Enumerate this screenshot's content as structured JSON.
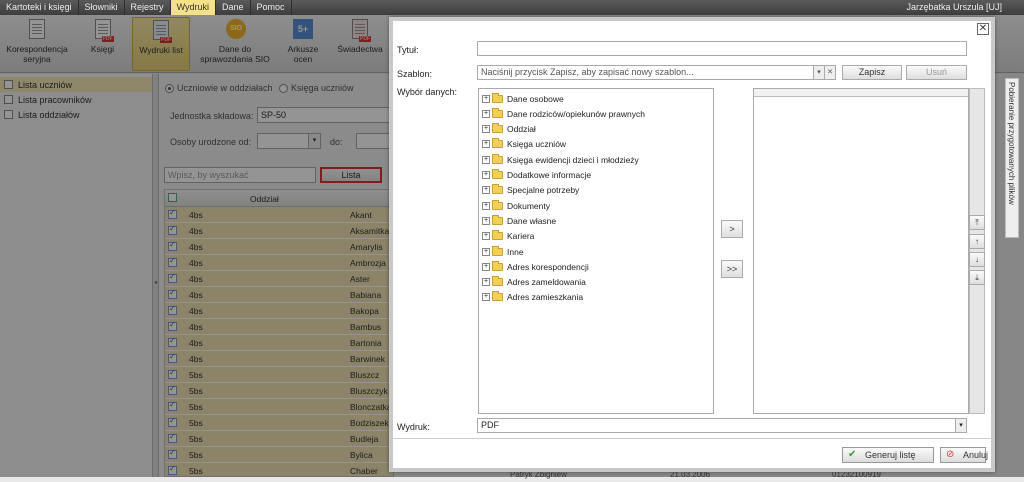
{
  "menu": [
    "Kartoteki i księgi",
    "Słowniki",
    "Rejestry",
    "Wydruki",
    "Dane",
    "Pomoc"
  ],
  "menu_active": 3,
  "user": "Jarzębatka Urszula [UJ]",
  "ribbon": [
    {
      "label": "Korespondencja seryjna",
      "icon": "document-icon"
    },
    {
      "label": "Księgi",
      "icon": "pdf-book-icon"
    },
    {
      "label": "Wydruki list",
      "icon": "list-pdf-icon"
    },
    {
      "label": "Dane do sprawozdania SIO",
      "icon": "sio-icon"
    },
    {
      "label": "Arkusze ocen",
      "icon": "grade-sheet-icon"
    },
    {
      "label": "Świadectwa",
      "icon": "certificate-icon"
    }
  ],
  "sidebar": [
    "Lista uczniów",
    "Lista pracowników",
    "Lista oddziałów"
  ],
  "filters": {
    "radio1": "Uczniowie w oddziałach",
    "radio2": "Księga uczniów",
    "unit_label": "Jednostka składowa:",
    "unit_value": "SP-50",
    "born_label": "Osoby urodzone od:",
    "to_label": "do:",
    "search_placeholder": "Wpisz, by wyszukać",
    "list_button": "Lista"
  },
  "grid": {
    "col_class": "Oddział",
    "rows": [
      [
        "4bs",
        "Akant"
      ],
      [
        "4bs",
        "Aksamitka"
      ],
      [
        "4bs",
        "Amarylis"
      ],
      [
        "4bs",
        "Ambrozja"
      ],
      [
        "4bs",
        "Aster"
      ],
      [
        "4bs",
        "Babiana"
      ],
      [
        "4bs",
        "Bakopa"
      ],
      [
        "4bs",
        "Bambus"
      ],
      [
        "4bs",
        "Bartonia"
      ],
      [
        "4bs",
        "Barwinek"
      ],
      [
        "5bs",
        "Bluszcz"
      ],
      [
        "5bs",
        "Bluszczyk"
      ],
      [
        "5bs",
        "Blonczatka"
      ],
      [
        "5bs",
        "Bodziszek"
      ],
      [
        "5bs",
        "Budleja"
      ],
      [
        "5bs",
        "Bylica"
      ],
      [
        "5bs",
        "Chaber"
      ]
    ],
    "last_row_extra": [
      "Patryk Zbigniew",
      "21.03.2006",
      "01232100919"
    ]
  },
  "right_panel": "Pobieranie przygotowanych plików",
  "dialog": {
    "title_label": "Tytuł:",
    "template_label": "Szablon:",
    "template_placeholder": "Naciśnij przycisk Zapisz, aby zapisać nowy szablon...",
    "save_button": "Zapisz",
    "delete_button": "Usuń",
    "data_label": "Wybór danych:",
    "tree": [
      "Dane osobowe",
      "Dane rodziców/opiekunów prawnych",
      "Oddział",
      "Księga uczniów",
      "Księga ewidencji dzieci i młodzieży",
      "Dodatkowe informacje",
      "Specjalne potrzeby",
      "Dokumenty",
      "Dane własne",
      "Kariera",
      "Inne",
      "Adres korespondencji",
      "Adres zameldowania",
      "Adres zamieszkania"
    ],
    "move_one": ">",
    "move_all": ">>",
    "print_label": "Wydruk:",
    "print_value": "PDF",
    "generate_button": "Generuj listę",
    "cancel_button": "Anuluj"
  }
}
